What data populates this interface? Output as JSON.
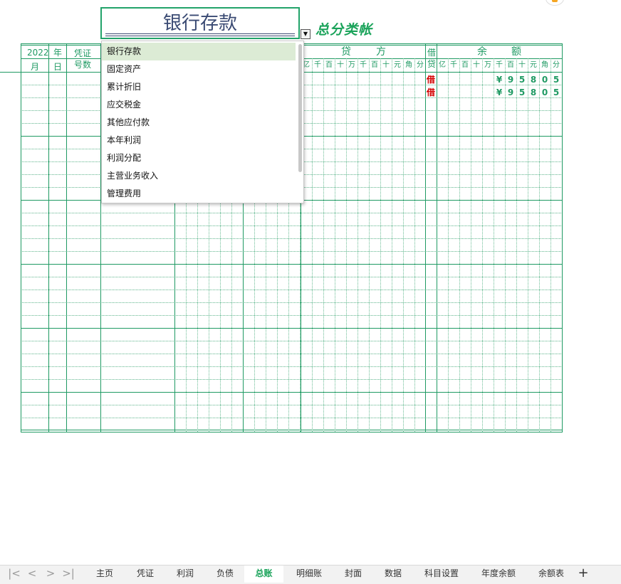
{
  "window": {
    "title": "总分类帐"
  },
  "account_selector": {
    "selected": "银行存款",
    "options": [
      "银行存款",
      "固定资产",
      "累计折旧",
      "应交税金",
      "其他应付款",
      "本年利润",
      "利润分配",
      "主营业务收入",
      "管理费用"
    ]
  },
  "ledger": {
    "year": "2022",
    "year_char": "年",
    "month": "月",
    "day": "日",
    "voucher_line1": "凭证",
    "voucher_line2": "号数",
    "credit_header": "贷",
    "credit_header2": "方",
    "balance_header": "余",
    "balance_header2": "额",
    "dc_line1": "借",
    "dc_line2": "贷",
    "credit_digits": [
      "亿",
      "千",
      "百",
      "十",
      "万",
      "千",
      "百",
      "十",
      "元",
      "角",
      "分"
    ],
    "balance_digits": [
      "亿",
      "千",
      "百",
      "十",
      "万",
      "千",
      "百",
      "十",
      "元",
      "角",
      "分"
    ],
    "rows": [
      {
        "dc": "借",
        "balance": [
          "¥",
          "9",
          "5",
          "8",
          "0",
          "5"
        ]
      },
      {
        "dc": "借",
        "balance": [
          "¥",
          "9",
          "5",
          "8",
          "0",
          "5"
        ]
      }
    ]
  },
  "sheet_tabs": {
    "items": [
      "主页",
      "凭证",
      "利润",
      "负债",
      "总账",
      "明细账",
      "封面",
      "数据",
      "科目设置",
      "年度余额",
      "余额表"
    ],
    "active": "总账"
  },
  "nav_icons": [
    "first-sheet-icon",
    "prev-sheet-icon",
    "next-sheet-icon",
    "last-sheet-icon"
  ],
  "colors": {
    "grid": "#1f9a63",
    "title_text": "#3a4a73",
    "debit_mark": "#d40000",
    "active_tab": "#1aa35a"
  }
}
